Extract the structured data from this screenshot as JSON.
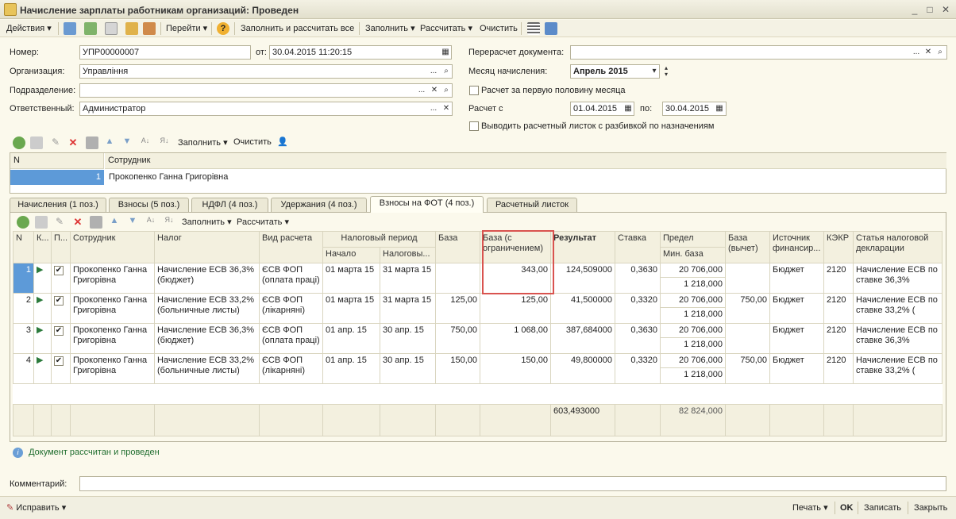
{
  "window": {
    "title": "Начисление зарплаты работникам организаций: Проведен"
  },
  "toolbar": {
    "actions": "Действия",
    "goto": "Перейти",
    "fill_calc_all": "Заполнить и рассчитать все",
    "fill": "Заполнить",
    "calc": "Рассчитать",
    "clear": "Очистить"
  },
  "form": {
    "number_label": "Номер:",
    "number": "УПР00000007",
    "date_label": "от:",
    "date": "30.04.2015 11:20:15",
    "org_label": "Организация:",
    "org": "Управління",
    "dept_label": "Подразделение:",
    "dept": "",
    "resp_label": "Ответственный:",
    "resp": "Администратор",
    "recalc_label": "Перерасчет документа:",
    "recalc": "",
    "month_label": "Месяц начисления:",
    "month": "Апрель 2015",
    "first_half_label": "Расчет за первую половину месяца",
    "from_label": "Расчет с",
    "from": "01.04.2015",
    "to_label": "по:",
    "to": "30.04.2015",
    "split_label": "Выводить расчетный листок с разбивкой по назначениям"
  },
  "emp_toolbar": {
    "fill": "Заполнить",
    "clear": "Очистить"
  },
  "emp_grid": {
    "h_n": "N",
    "h_emp": "Сотрудник",
    "rows": [
      {
        "n": "1",
        "name": "Прокопенко Ганна Григорівна"
      }
    ]
  },
  "tabs": [
    "Начисления (1 поз.)",
    "Взносы (5 поз.)",
    "НДФЛ (4 поз.)",
    "Удержания (4 поз.)",
    "Взносы на ФОТ (4 поз.)",
    "Расчетный листок"
  ],
  "tab_toolbar": {
    "fill": "Заполнить",
    "calc": "Рассчитать"
  },
  "grid": {
    "headers": {
      "n": "N",
      "k": "К...",
      "p": "П...",
      "emp": "Сотрудник",
      "tax": "Налог",
      "calc_type": "Вид расчета",
      "period": "Налоговый период",
      "start": "Начало",
      "tax_period": "Налоговы...",
      "base": "База",
      "base_limit": "База (с ограничением)",
      "result": "Результат",
      "rate": "Ставка",
      "limit": "Предел",
      "min_base": "Мин. база",
      "base_deduct": "База (вычет)",
      "source": "Источник финансир...",
      "kekr": "КЭКР",
      "decl": "Статья налоговой декларации"
    },
    "rows": [
      {
        "n": "1",
        "emp": "Прокопенко Ганна Григорівна",
        "tax": "Начисление ЕСВ 36,3% (бюджет)",
        "calc_type": "ЄСВ ФОП (оплата праці)",
        "start": "01 марта 15",
        "end": "31 марта 15",
        "base": "",
        "base_limit": "343,00",
        "result": "124,509000",
        "rate": "0,3630",
        "limit": "20 706,000",
        "min_base": "1 218,000",
        "base_deduct": "",
        "source": "Бюджет",
        "kekr": "2120",
        "decl": "Начисление ЕСВ по ставке 36,3%"
      },
      {
        "n": "2",
        "emp": "Прокопенко Ганна Григорівна",
        "tax": "Начисление ЕСВ 33,2% (больничные листы)",
        "calc_type": "ЄСВ ФОП (лікарняні)",
        "start": "01 марта 15",
        "end": "31 марта 15",
        "base": "125,00",
        "base_limit": "125,00",
        "result": "41,500000",
        "rate": "0,3320",
        "limit": "20 706,000",
        "min_base": "1 218,000",
        "base_deduct": "750,00",
        "source": "Бюджет",
        "kekr": "2120",
        "decl": "Начисление ЕСВ по ставке 33,2% ("
      },
      {
        "n": "3",
        "emp": "Прокопенко Ганна Григорівна",
        "tax": "Начисление ЕСВ 36,3% (бюджет)",
        "calc_type": "ЄСВ ФОП (оплата праці)",
        "start": "01 апр. 15",
        "end": "30 апр. 15",
        "base": "750,00",
        "base_limit": "1 068,00",
        "result": "387,684000",
        "rate": "0,3630",
        "limit": "20 706,000",
        "min_base": "1 218,000",
        "base_deduct": "",
        "source": "Бюджет",
        "kekr": "2120",
        "decl": "Начисление ЕСВ по ставке 36,3%"
      },
      {
        "n": "4",
        "emp": "Прокопенко Ганна Григорівна",
        "tax": "Начисление ЕСВ 33,2% (больничные листы)",
        "calc_type": "ЄСВ ФОП (лікарняні)",
        "start": "01 апр. 15",
        "end": "30 апр. 15",
        "base": "150,00",
        "base_limit": "150,00",
        "result": "49,800000",
        "rate": "0,3320",
        "limit": "20 706,000",
        "min_base": "1 218,000",
        "base_deduct": "750,00",
        "source": "Бюджет",
        "kekr": "2120",
        "decl": "Начисление ЕСВ по ставке 33,2% ("
      }
    ],
    "total_result": "603,493000",
    "total_limit": "82 824,000"
  },
  "status": "Документ рассчитан и проведен",
  "comment_label": "Комментарий:",
  "comment": "",
  "bottom": {
    "edit": "Исправить",
    "print": "Печать",
    "ok": "OK",
    "save": "Записать",
    "close": "Закрыть"
  }
}
